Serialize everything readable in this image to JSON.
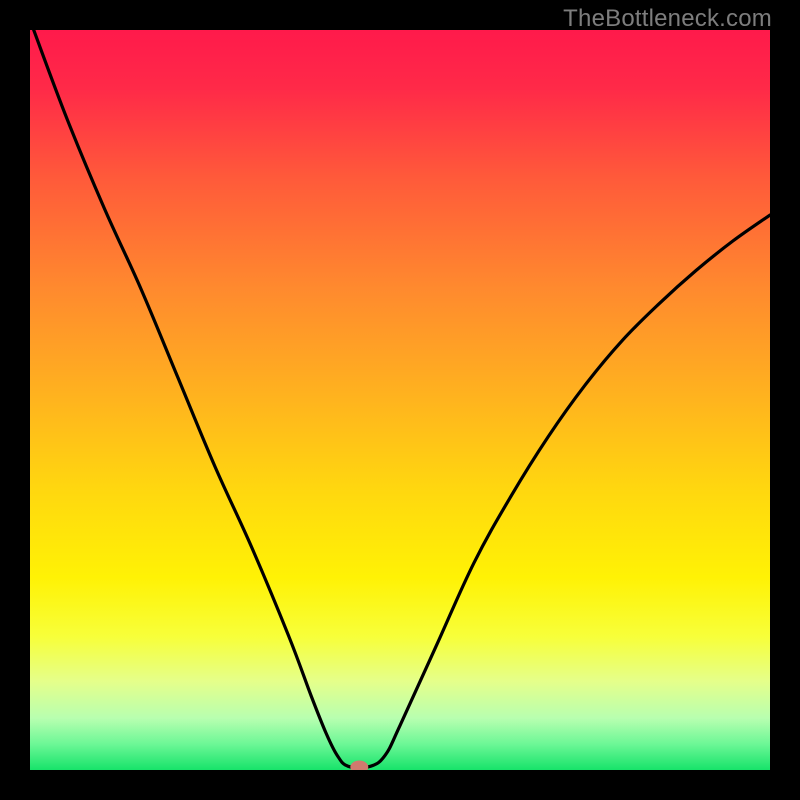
{
  "watermark": "TheBottleneck.com",
  "chart_data": {
    "type": "line",
    "title": "",
    "xlabel": "",
    "ylabel": "",
    "xlim": [
      0,
      100
    ],
    "ylim": [
      0,
      100
    ],
    "background_gradient_stops": [
      {
        "offset": 0.0,
        "color": "#ff1a4b"
      },
      {
        "offset": 0.08,
        "color": "#ff2a48"
      },
      {
        "offset": 0.2,
        "color": "#ff5a3a"
      },
      {
        "offset": 0.35,
        "color": "#ff8a2e"
      },
      {
        "offset": 0.5,
        "color": "#ffb41e"
      },
      {
        "offset": 0.62,
        "color": "#ffd70f"
      },
      {
        "offset": 0.74,
        "color": "#fff205"
      },
      {
        "offset": 0.82,
        "color": "#f7ff3a"
      },
      {
        "offset": 0.88,
        "color": "#e5ff8a"
      },
      {
        "offset": 0.93,
        "color": "#b8ffb0"
      },
      {
        "offset": 0.965,
        "color": "#6cf796"
      },
      {
        "offset": 1.0,
        "color": "#17e36a"
      }
    ],
    "series": [
      {
        "name": "curve",
        "x": [
          0.5,
          5,
          10,
          15,
          20,
          25,
          30,
          35,
          38,
          40,
          41.5,
          43,
          46,
          48,
          50,
          55,
          60,
          65,
          70,
          75,
          80,
          85,
          90,
          95,
          100
        ],
        "y": [
          100,
          88,
          76,
          65,
          53,
          41,
          30,
          18,
          10,
          5,
          2,
          0.5,
          0.5,
          2,
          6,
          17,
          28,
          37,
          45,
          52,
          58,
          63,
          67.5,
          71.5,
          75
        ]
      }
    ],
    "marker": {
      "x": 44.5,
      "y": 0.4,
      "color": "#d07a6e"
    }
  }
}
